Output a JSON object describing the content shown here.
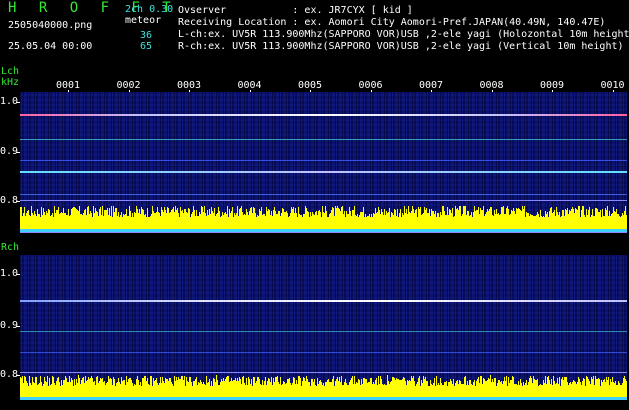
{
  "header": {
    "app_name": "H R O F F T",
    "version": "2ch 0.30",
    "filename": "2505040000.png",
    "datetime": "25.05.04 00:00",
    "meteor_label": "meteor",
    "meteor_l": "36",
    "meteor_r": "65",
    "observer_line": "Ovserver           : ex. JR7CYX [ kid ]",
    "location_line": "Receiving Location : ex. Aomori City Aomori-Pref.JAPAN(40.49N, 140.47E)",
    "lch_line": "L-ch:ex. UV5R 113.900Mhz(SAPPORO VOR)USB ,2-ele yagi (Holozontal 10m height)",
    "rch_line": "R-ch:ex. UV5R 113.900Mhz(SAPPORO VOR)USB ,2-ele yagi (Vertical 10m height)"
  },
  "left_channel": {
    "label": "Lch",
    "unit": "kHz",
    "y_ticks": [
      "1.0",
      "0.9",
      "0.8"
    ]
  },
  "right_channel": {
    "label": "Rch",
    "y_ticks": [
      "1.0",
      "0.9",
      "0.8"
    ]
  },
  "x_axis": {
    "ticks": [
      "0001",
      "0002",
      "0003",
      "0004",
      "0005",
      "0006",
      "0007",
      "0008",
      "0009",
      "0010"
    ]
  },
  "colors": {
    "label_green": "#34e834",
    "background_blue": "#0a0f6a",
    "bar_yellow": "#ffff00",
    "carrier": "#c0c0ff"
  }
}
